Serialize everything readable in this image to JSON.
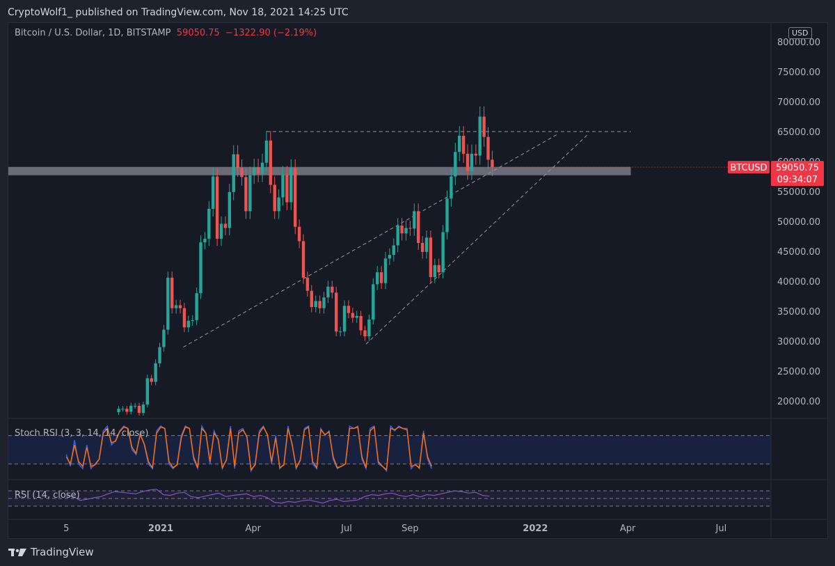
{
  "publisher": "CryptoWolf1_ published on TradingView.com, Nov 18, 2021 14:25 UTC",
  "legend": {
    "symbol": "Bitcoin / U.S. Dollar, 1D, BITSTAMP",
    "price": "59050.75",
    "change": "−1322.90 (−2.19%)"
  },
  "currency": "USD",
  "footer_brand": "TradingView",
  "colors": {
    "up": "#26a69a",
    "down": "#ef5350",
    "stoch_k": "#2962ff",
    "stoch_d": "#ff6d00",
    "rsi": "#7e57c2",
    "price_tag": "#f23645",
    "zone": "#787b86"
  },
  "price_tag": {
    "symbol": "BTCUSD",
    "price": "59050.75",
    "countdown": "09:34:07"
  },
  "chart_data": {
    "type": "candlestick",
    "interval": "1D",
    "y_ticks": [
      "80000.00",
      "75000.00",
      "70000.00",
      "65000.00",
      "60000.00",
      "55000.00",
      "50000.00",
      "45000.00",
      "40000.00",
      "35000.00",
      "30000.00",
      "25000.00",
      "20000.00"
    ],
    "ylim": [
      17200,
      82000
    ],
    "x_ticks": [
      {
        "label": "5",
        "date": "2020-10-01"
      },
      {
        "label": "2021",
        "date": "2021-01-01"
      },
      {
        "label": "Apr",
        "date": "2021-04-01"
      },
      {
        "label": "Jul",
        "date": "2021-07-01"
      },
      {
        "label": "Sep",
        "date": "2021-09-01"
      },
      {
        "label": "2022",
        "date": "2022-01-01"
      },
      {
        "label": "Apr",
        "date": "2022-04-01"
      },
      {
        "label": "Jul",
        "date": "2022-07-01"
      }
    ],
    "series_start": "2020-11-21",
    "sample_step_days": 4,
    "closes": [
      18700,
      18700,
      18200,
      19200,
      19200,
      18000,
      19400,
      23800,
      23200,
      26300,
      29000,
      31900,
      40600,
      35500,
      36000,
      35500,
      32300,
      33400,
      33500,
      38000,
      46500,
      47100,
      52100,
      57500,
      47100,
      49600,
      48900,
      54900,
      61200,
      58900,
      57400,
      51700,
      57700,
      59000,
      58000,
      59800,
      63500,
      56100,
      51700,
      54000,
      57800,
      53200,
      58900,
      49100,
      46700,
      40600,
      38400,
      35700,
      36700,
      35500,
      37300,
      39100,
      38100,
      31600,
      31600,
      35900,
      34700,
      33900,
      34200,
      31800,
      30800,
      33600,
      39500,
      41500,
      39700,
      43800,
      44400,
      46000,
      49300,
      48000,
      48900,
      48800,
      51700,
      46400,
      44900,
      47300,
      40700,
      42700,
      41500,
      48200,
      53800,
      57500,
      61600,
      64300,
      61300,
      58400,
      61300,
      61000,
      67500,
      64100,
      60300,
      59050
    ],
    "drawings": {
      "support_zone": {
        "from": "2020-08-01",
        "to": "2022-04-04",
        "low": 57700,
        "high": 59100
      },
      "resistance_line": {
        "from": "2021-04-14",
        "to": "2022-04-04",
        "price": 65000
      },
      "trendline_1": [
        {
          "date": "2021-01-23",
          "price": 29000
        },
        {
          "date": "2022-01-22",
          "price": 64500
        }
      ],
      "trendline_2": [
        {
          "date": "2021-07-20",
          "price": 29500
        },
        {
          "date": "2022-02-21",
          "price": 64500
        }
      ]
    },
    "stoch_rsi": {
      "label": "Stoch RSI (3, 3, 14, 14, close)",
      "bands": [
        80,
        20
      ],
      "sample_step_days": 4,
      "start": "2020-10-01",
      "k": [
        40,
        15,
        70,
        20,
        10,
        60,
        10,
        20,
        30,
        90,
        100,
        60,
        70,
        90,
        100,
        95,
        50,
        40,
        85,
        60,
        20,
        10,
        90,
        100,
        95,
        20,
        10,
        20,
        80,
        100,
        95,
        30,
        10,
        100,
        85,
        20,
        90,
        70,
        10,
        30,
        100,
        10,
        90,
        95,
        75,
        5,
        20,
        90,
        100,
        80,
        20,
        80,
        10,
        20,
        100,
        60,
        10,
        30,
        95,
        100,
        20,
        10,
        95,
        80,
        90,
        30,
        10,
        15,
        20,
        100,
        95,
        100,
        30,
        10,
        95,
        100,
        20,
        15,
        5,
        100,
        90,
        100,
        95,
        95,
        10,
        20,
        10,
        90,
        30,
        10
      ],
      "d": [
        35,
        20,
        60,
        25,
        15,
        55,
        15,
        18,
        30,
        85,
        95,
        65,
        68,
        88,
        98,
        95,
        55,
        42,
        82,
        62,
        25,
        12,
        85,
        98,
        95,
        25,
        12,
        18,
        75,
        98,
        95,
        35,
        12,
        95,
        85,
        25,
        85,
        72,
        12,
        28,
        95,
        15,
        85,
        92,
        78,
        8,
        18,
        85,
        98,
        82,
        25,
        75,
        12,
        18,
        95,
        62,
        12,
        28,
        92,
        98,
        25,
        12,
        92,
        82,
        88,
        35,
        12,
        15,
        20,
        95,
        95,
        98,
        35,
        12,
        90,
        98,
        25,
        15,
        8,
        95,
        92,
        98,
        95,
        92,
        15,
        18,
        12,
        85,
        35,
        15
      ]
    },
    "rsi": {
      "label": "RSI (14, close)",
      "bands": [
        70,
        50,
        30
      ],
      "sample_step_days": 4,
      "start": "2020-10-01",
      "values": [
        58,
        55,
        45,
        48,
        52,
        55,
        62,
        68,
        66,
        64,
        62,
        68,
        72,
        74,
        60,
        58,
        64,
        66,
        55,
        52,
        56,
        60,
        64,
        55,
        58,
        60,
        62,
        55,
        58,
        52,
        40,
        38,
        42,
        40,
        44,
        46,
        42,
        38,
        45,
        48,
        42,
        44,
        46,
        55,
        60,
        58,
        62,
        64,
        58,
        55,
        60,
        54,
        60,
        58,
        62,
        66,
        70,
        68,
        64,
        66,
        58,
        56
      ]
    }
  }
}
